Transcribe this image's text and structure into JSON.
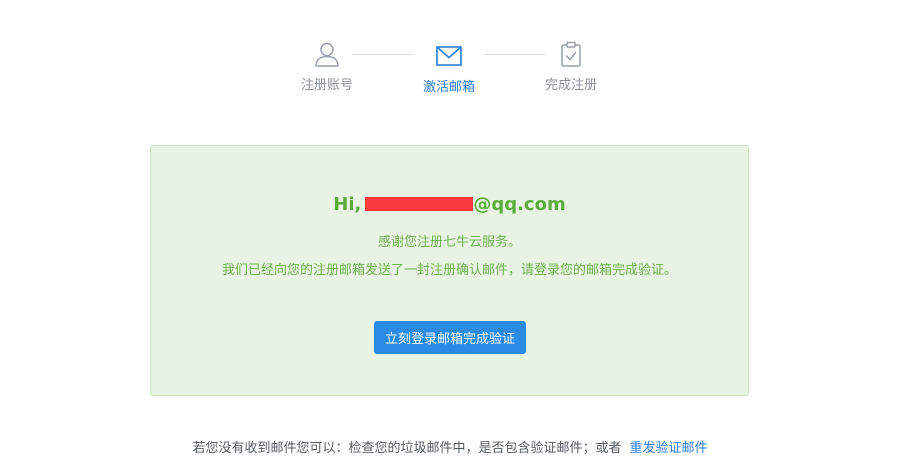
{
  "steps": [
    {
      "label": "注册账号",
      "icon": "user-icon",
      "state": "done"
    },
    {
      "label": "激活邮箱",
      "icon": "mail-icon",
      "state": "active"
    },
    {
      "label": "完成注册",
      "icon": "clipboard-check-icon",
      "state": "pending"
    }
  ],
  "colors": {
    "accent": "#2b7de0",
    "button": "#2b8ae4",
    "success_text": "#5aad3a",
    "panel_bg": "#e9f3e3",
    "panel_border": "#cfe3c3",
    "redaction": "#fb3b3b"
  },
  "panel": {
    "greeting_prefix": "Hi,",
    "email_domain": "@qq.com",
    "thanks": "感谢您注册七牛云服务。",
    "instruction": "我们已经向您的注册邮箱发送了一封注册确认邮件，请登录您的邮箱完成验证。",
    "verify_button": "立刻登录邮箱完成验证"
  },
  "footer": {
    "text": "若您没有收到邮件您可以：检查您的垃圾邮件中，是否包含验证邮件；或者",
    "resend_link": "重发验证邮件"
  }
}
